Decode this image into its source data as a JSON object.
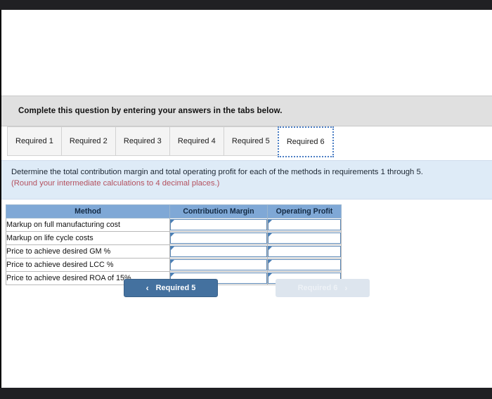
{
  "banner": {
    "text": "Complete this question by entering your answers in the tabs below."
  },
  "tabs": [
    {
      "label": "Required 1",
      "active": false
    },
    {
      "label": "Required 2",
      "active": false
    },
    {
      "label": "Required 3",
      "active": false
    },
    {
      "label": "Required 4",
      "active": false
    },
    {
      "label": "Required 5",
      "active": false
    },
    {
      "label": "Required 6",
      "active": true
    }
  ],
  "question": {
    "prompt": "Determine the total contribution margin and total operating profit for each of the methods in requirements 1 through 5.",
    "note": "(Round your intermediate calculations to 4 decimal places.)"
  },
  "table": {
    "headers": {
      "method": "Method",
      "contribution_margin": "Contribution Margin",
      "operating_profit": "Operating Profit"
    },
    "rows": [
      {
        "method": "Markup on full manufacturing cost",
        "contribution_margin": "",
        "operating_profit": ""
      },
      {
        "method": "Markup on life cycle costs",
        "contribution_margin": "",
        "operating_profit": ""
      },
      {
        "method": "Price to achieve desired GM %",
        "contribution_margin": "",
        "operating_profit": ""
      },
      {
        "method": "Price to achieve desired LCC %",
        "contribution_margin": "",
        "operating_profit": ""
      },
      {
        "method": "Price to achieve desired ROA of 15%",
        "contribution_margin": "",
        "operating_profit": ""
      }
    ]
  },
  "navigation": {
    "prev_label": "Required 5",
    "next_label": "Required 6",
    "prev_icon": "chevron-left-icon",
    "next_icon": "chevron-right-icon",
    "prev_glyph": "‹",
    "next_glyph": "›",
    "next_disabled": true
  },
  "colors": {
    "banner_bg": "#e0e0e0",
    "panel_bg": "#deebf7",
    "table_header_bg": "#7fa8d6",
    "note_text": "#b4515f",
    "prev_button_bg": "#44719f",
    "next_button_bg": "#dde5ee",
    "input_border": "#5b87b5",
    "active_tab_focus": "#4b7ec4"
  }
}
